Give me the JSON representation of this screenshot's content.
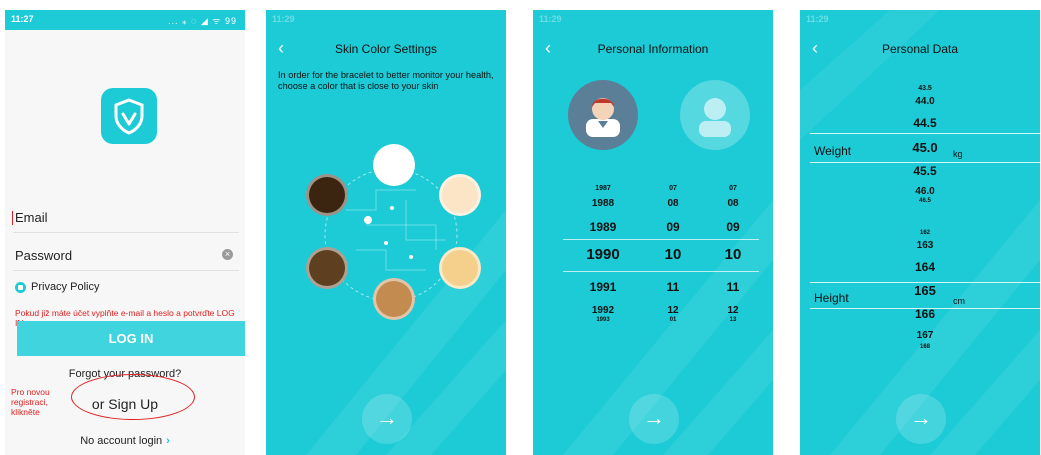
{
  "screen1": {
    "status_time": "11:27",
    "status_icons": "... ⁎ ◌ ◢ ᯤ 99",
    "email_label": "Email",
    "password_label": "Password",
    "privacy_label": "Privacy Policy",
    "note_login": "Pokud již máte účet vyplňte e-mail a heslo a potvrďte LOG IN.",
    "login_label": "LOG IN",
    "forgot_label": "Forgot your password?",
    "signup_label": "or Sign Up",
    "note_signup": "Pro novou registraci, klikněte",
    "no_account_label": "No account login"
  },
  "screen2": {
    "status_time": "11:29",
    "title": "Skin Color Settings",
    "intro": "In order for the bracelet to better monitor your health, choose a color that is close to your skin",
    "swatches": [
      "#ffffff",
      "#3b2410",
      "#fce4c6",
      "#5e4020",
      "#f4d08c",
      "#c48b50"
    ]
  },
  "screen3": {
    "status_time": "11:29",
    "title": "Personal Information",
    "years": [
      "1987",
      "1988",
      "1989",
      "1990",
      "1991",
      "1992",
      "1993"
    ],
    "months": [
      "07",
      "08",
      "09",
      "10",
      "11",
      "12",
      "01"
    ],
    "days": [
      "07",
      "08",
      "09",
      "10",
      "11",
      "12",
      "13"
    ]
  },
  "screen4": {
    "status_time": "11:29",
    "title": "Personal Data",
    "weight_label": "Weight",
    "weight_unit": "kg",
    "weights": [
      "43.5",
      "44.0",
      "44.5",
      "45.0",
      "45.5",
      "46.0",
      "46.5"
    ],
    "height_label": "Height",
    "height_unit": "cm",
    "heights": [
      "162",
      "163",
      "164",
      "165",
      "166",
      "167",
      "168"
    ]
  }
}
